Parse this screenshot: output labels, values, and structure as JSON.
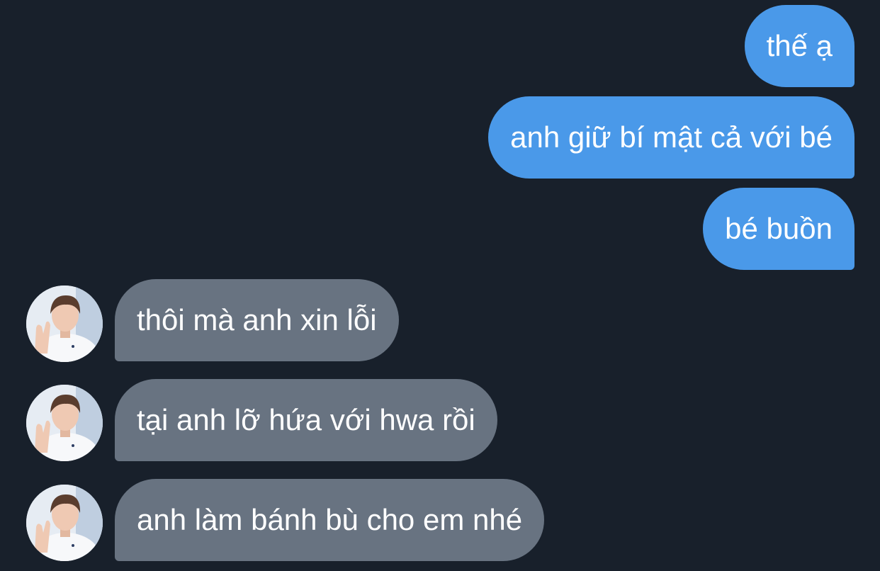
{
  "conversation": {
    "messages": [
      {
        "direction": "outgoing",
        "text": "thế ạ"
      },
      {
        "direction": "outgoing",
        "text": "anh giữ bí mật cả với bé"
      },
      {
        "direction": "outgoing",
        "text": "bé buồn"
      },
      {
        "direction": "incoming",
        "text": "thôi mà anh xin lỗi",
        "avatar": "user-avatar-photo"
      },
      {
        "direction": "incoming",
        "text": "tại anh lỡ hứa với hwa rồi",
        "avatar": "user-avatar-photo"
      },
      {
        "direction": "incoming",
        "text": "anh làm bánh bù cho em nhé",
        "avatar": "user-avatar-photo"
      }
    ]
  },
  "colors": {
    "background": "#18202b",
    "outgoing_bubble": "#4a99e9",
    "incoming_bubble": "#687381",
    "bubble_text": "#ffffff"
  }
}
